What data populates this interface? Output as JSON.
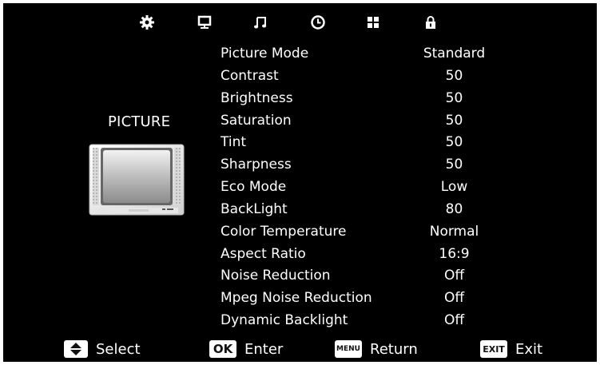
{
  "top_icons": [
    "gear-icon",
    "monitor-icon",
    "music-note-icon",
    "clock-icon",
    "grid-icon",
    "lock-icon"
  ],
  "section_title": "PICTURE",
  "menu_items": [
    {
      "label": "Picture Mode",
      "value": "Standard"
    },
    {
      "label": "Contrast",
      "value": "50"
    },
    {
      "label": "Brightness",
      "value": "50"
    },
    {
      "label": "Saturation",
      "value": "50"
    },
    {
      "label": "Tint",
      "value": "50"
    },
    {
      "label": "Sharpness",
      "value": "50"
    },
    {
      "label": "Eco Mode",
      "value": "Low"
    },
    {
      "label": "BackLight",
      "value": "80"
    },
    {
      "label": "Color Temperature",
      "value": "Normal"
    },
    {
      "label": "Aspect Ratio",
      "value": "16:9"
    },
    {
      "label": "Noise Reduction",
      "value": "Off"
    },
    {
      "label": "Mpeg Noise Reduction",
      "value": "Off"
    },
    {
      "label": "Dynamic Backlight",
      "value": "Off"
    }
  ],
  "hints": {
    "select": {
      "key_icon": "up-down-arrows-icon",
      "label": "Select"
    },
    "enter": {
      "key": "OK",
      "label": "Enter"
    },
    "return": {
      "key": "MENU",
      "label": "Return"
    },
    "exit": {
      "key": "EXIT",
      "label": "Exit"
    }
  },
  "colors": {
    "background": "#000000",
    "text": "#ffffff",
    "key_background": "#ffffff"
  }
}
